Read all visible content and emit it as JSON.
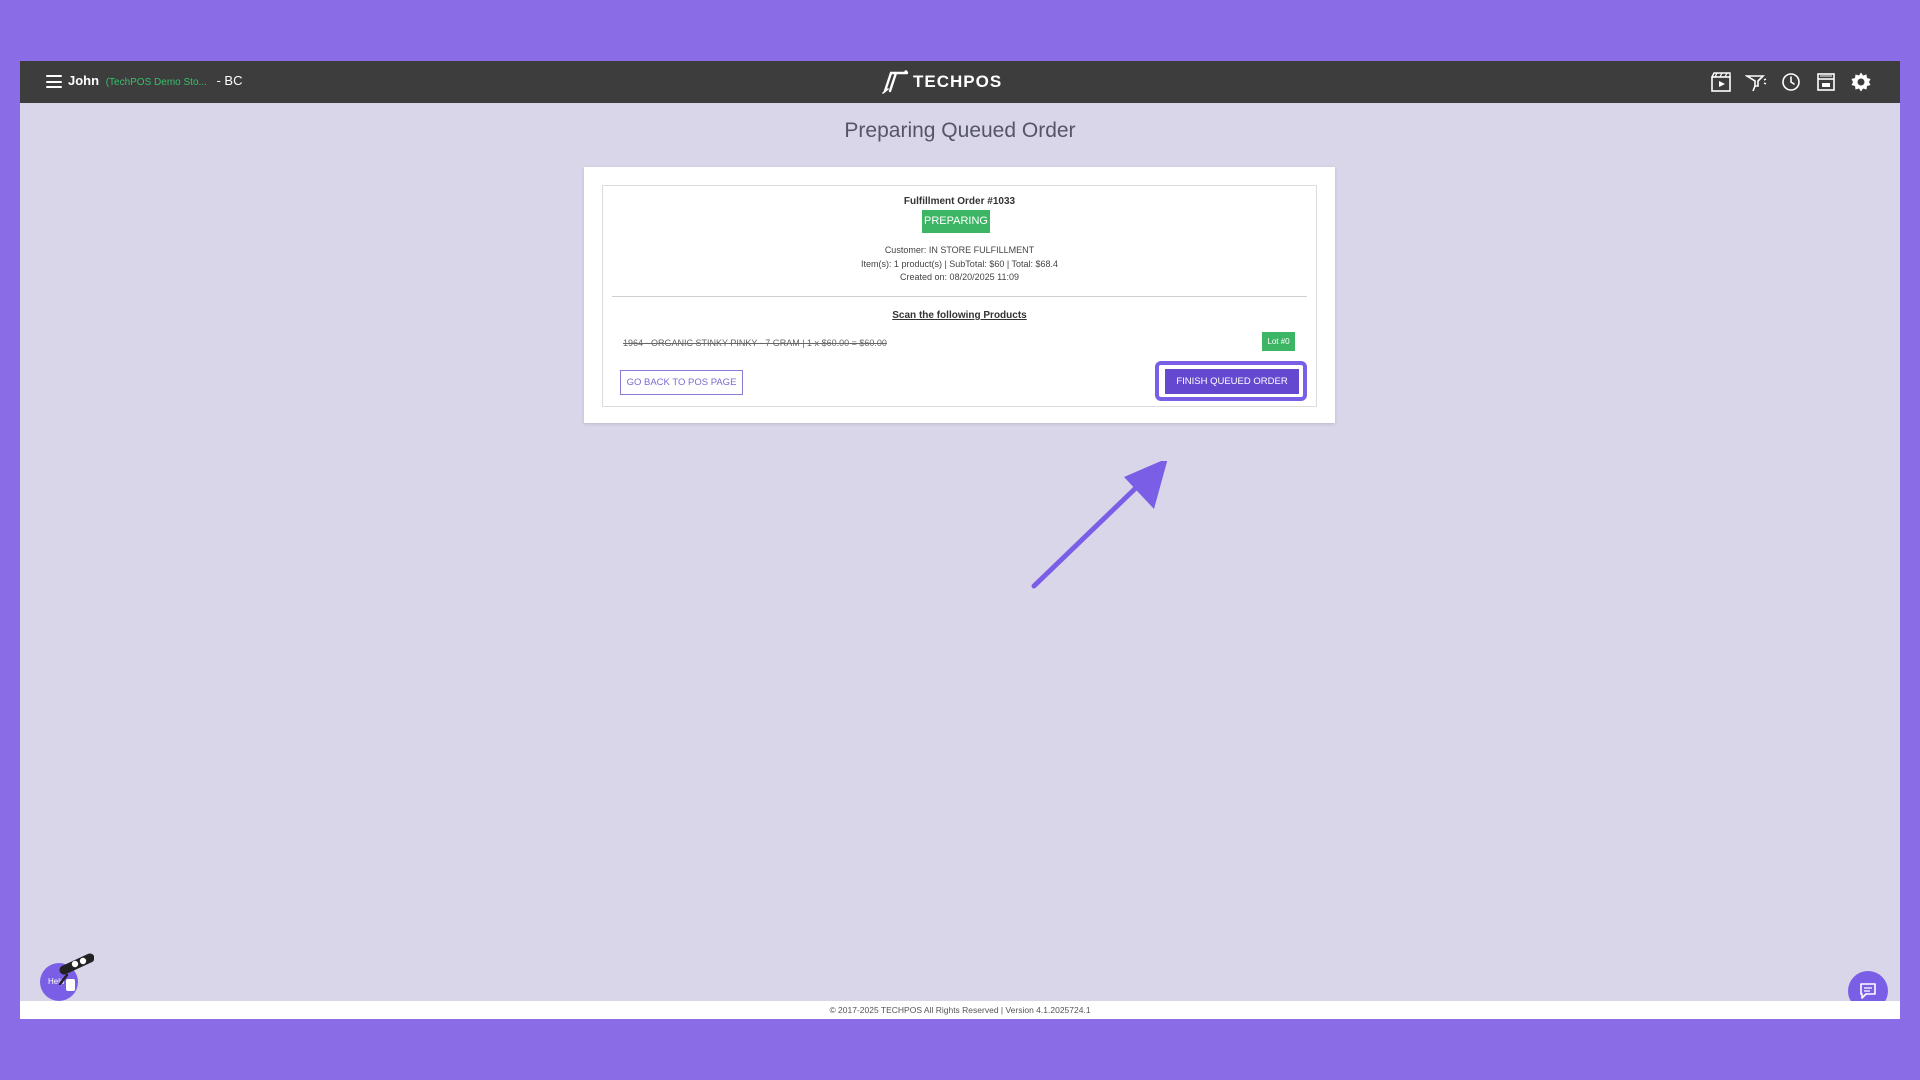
{
  "header": {
    "user_name": "John",
    "store_name": "(TechPOS Demo Sto...",
    "region": "- BC",
    "brand": "TECHPOS",
    "icons": [
      "film-icon",
      "megaphone-icon",
      "clock-icon",
      "store-icon",
      "gear-icon"
    ]
  },
  "page": {
    "title": "Preparing Queued Order"
  },
  "order": {
    "title": "Fulfillment Order #1033",
    "status": "PREPARING",
    "customer": "Customer: IN STORE FULFILLMENT",
    "items_summary": "Item(s): 1 product(s) | SubTotal: $60 | Total: $68.4",
    "created": "Created on: 08/20/2025 11:09",
    "scan_title": "Scan the following Products",
    "products": [
      {
        "line": "1964 - ORGANIC STINKY PINKY - 7 GRAM | 1 x $60.00 = $60.00",
        "lot": "Lot #0"
      }
    ],
    "back_label": "GO BACK TO POS PAGE",
    "finish_label": "FINISH QUEUED ORDER"
  },
  "footer": {
    "text": "© 2017-2025 TECHPOS All Rights Reserved | Version 4.1.2025724.1"
  },
  "help": {
    "label": "Help"
  },
  "colors": {
    "frame": "#8a6de6",
    "topbar": "#3d3d3d",
    "page_bg": "#d9d6ea",
    "status_green": "#3cb664",
    "accent_purple": "#6548d0"
  }
}
